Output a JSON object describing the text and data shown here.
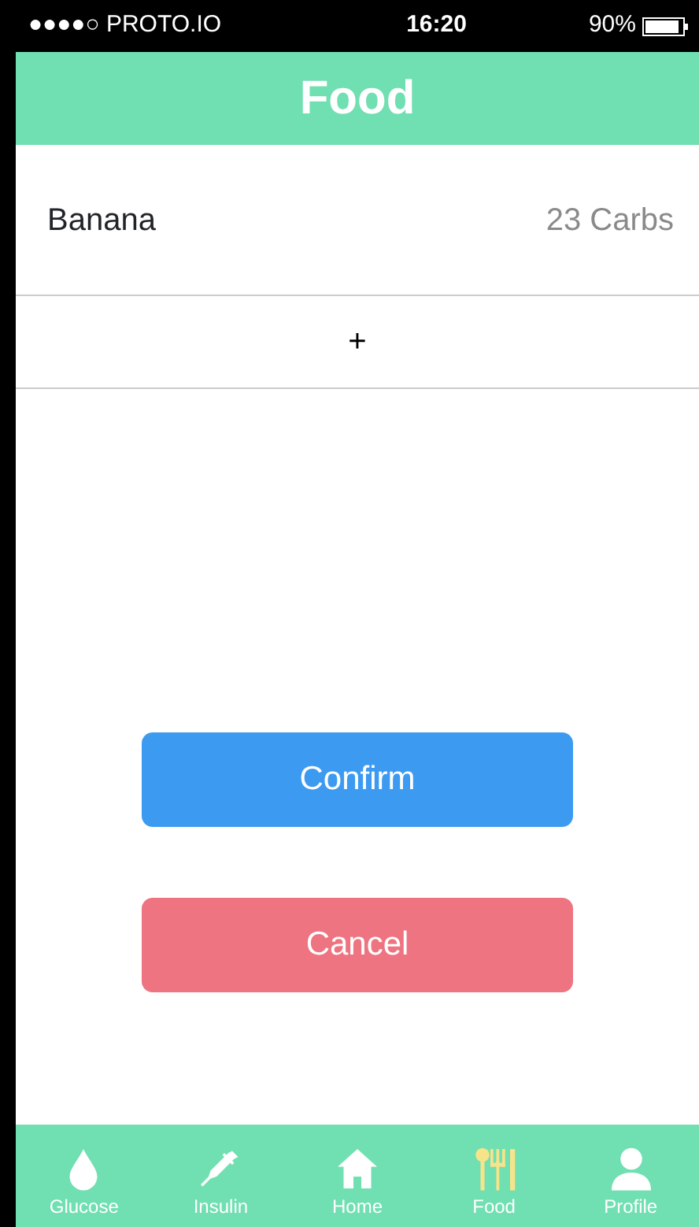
{
  "status_bar": {
    "carrier": "●●●●○ PROTO.IO",
    "time": "16:20",
    "battery": "90%"
  },
  "header": {
    "title": "Food"
  },
  "foods": [
    {
      "name": "Banana",
      "carbs": "23 Carbs"
    }
  ],
  "add_button": "+",
  "buttons": [
    {
      "kind": "confirm",
      "label": "Confirm"
    },
    {
      "kind": "cancel",
      "label": "Cancel"
    }
  ],
  "tabs": [
    {
      "kind": "drop",
      "label": "Glucose",
      "selected": false
    },
    {
      "kind": "syringe",
      "label": "Insulin",
      "selected": false
    },
    {
      "kind": "house",
      "label": "Home",
      "selected": false
    },
    {
      "kind": "cutlery",
      "label": "Food",
      "selected": true
    },
    {
      "kind": "person",
      "label": "Profile",
      "selected": false
    }
  ]
}
